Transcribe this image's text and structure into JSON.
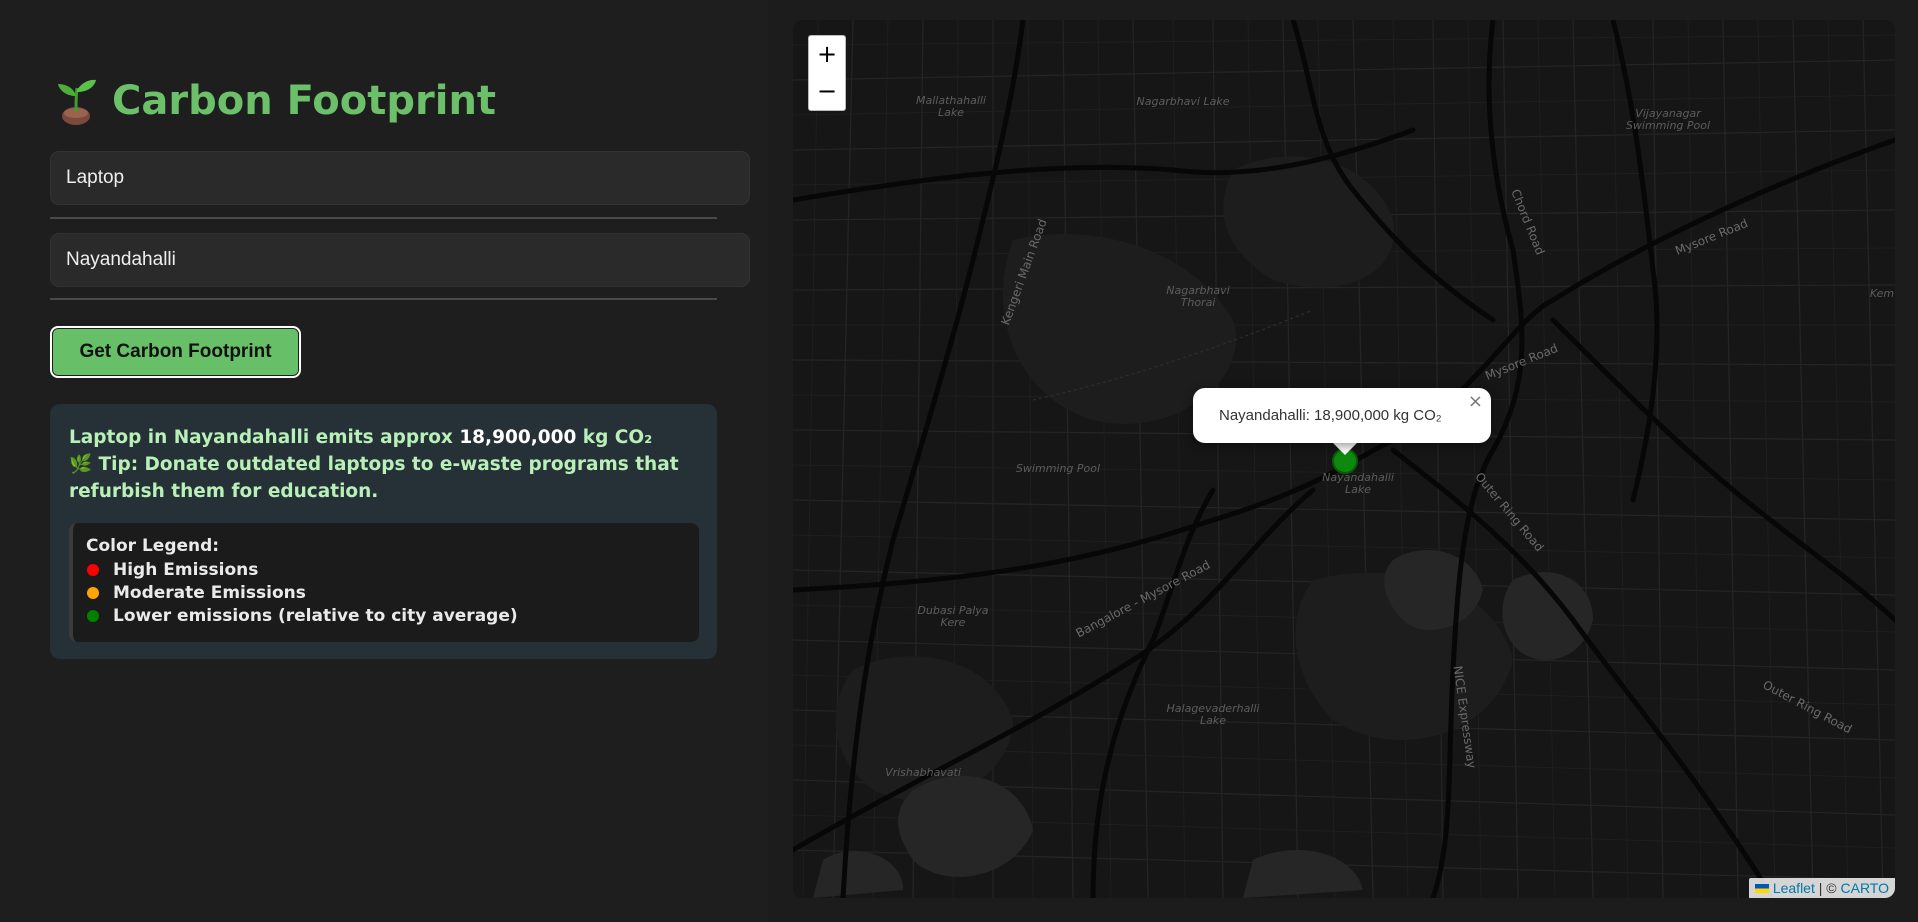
{
  "app": {
    "title": "Carbon Footprint",
    "title_icon": "seedling-icon"
  },
  "form": {
    "product_value": "Laptop",
    "location_value": "Nayandahalli",
    "submit_label": "Get Carbon Footprint"
  },
  "result": {
    "line1_prefix": "Laptop in Nayandahalli emits approx ",
    "line1_value": "18,900,000",
    "line1_suffix": " kg CO₂",
    "tip_icon": "herb-icon",
    "tip_glyph": "🌿",
    "tip_text": " Tip: Donate outdated laptops to e-waste programs that refurbish them for education."
  },
  "legend": {
    "title": "Color Legend:",
    "items": [
      {
        "label": "High Emissions",
        "color": "#ff0000"
      },
      {
        "label": "Moderate Emissions",
        "color": "#ffa500"
      },
      {
        "label": "Lower emissions (relative to city average)",
        "color": "#008000"
      }
    ]
  },
  "map": {
    "zoom_in": "+",
    "zoom_out": "−",
    "popup_text": "Nayandahalli: 18,900,000 kg CO₂",
    "popup_close": "×",
    "marker_color": "#008000",
    "place_labels": {
      "mallathahalli_lake": "Mallathahalli Lake",
      "nagarbhavi_lake": "Nagarbhavi Lake",
      "vijayanagar_pool": "Vijayanagar Swimming Pool",
      "nagarbhavi_thorai": "Nagarbhavi Thorai",
      "swimming_pool": "Swimming Pool",
      "nayandahalli_lake": "Nayandahalli Lake",
      "dubasi_palya_kere": "Dubasi Palya Kere",
      "halagevaderhalli_lake": "Halagevaderhalli Lake",
      "vrishabhavati": "Vrishabhavati",
      "kem": "Kem"
    },
    "road_labels": {
      "mysore_road_1": "Mysore Road",
      "mysore_road_2": "Mysore Road",
      "chord_road": "Chord Road",
      "outer_ring_road": "Outer Ring Road",
      "outer_ring_road_2": "Outer Ring Road",
      "bangalore_mysore_road": "Bangalore - Mysore Road",
      "kengeri_main_road": "Kengeri Main Road",
      "nice_expressway": "NICE Expressway"
    },
    "attribution": {
      "leaflet": "Leaflet",
      "separator": " | © ",
      "carto": "CARTO"
    },
    "colors": {
      "background": "#151515",
      "roads": "#2b2b2b",
      "major_roads": "#0a0a0a"
    }
  }
}
